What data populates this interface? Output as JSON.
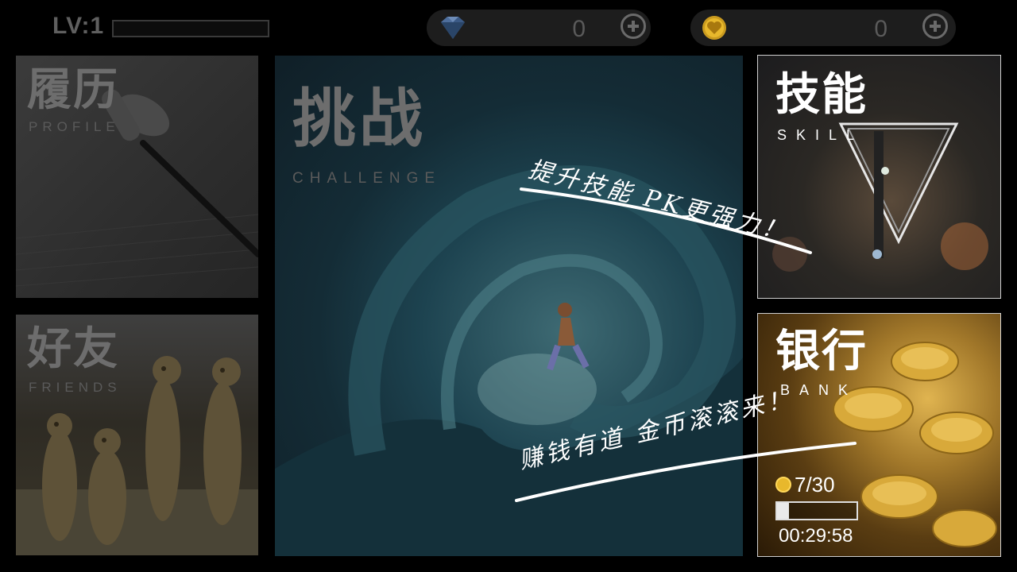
{
  "hud": {
    "level_label": "LV:1",
    "xp_progress": 0,
    "gems": {
      "icon": "diamond-icon",
      "value": "0"
    },
    "hearts": {
      "icon": "heart-coin-icon",
      "value": "0"
    }
  },
  "tiles": {
    "profile": {
      "title": "履历",
      "subtitle": "PROFILE"
    },
    "friends": {
      "title": "好友",
      "subtitle": "FRIENDS"
    },
    "challenge": {
      "title": "挑战",
      "subtitle": "CHALLENGE"
    },
    "skill": {
      "title": "技能",
      "subtitle": "SKILL"
    },
    "bank": {
      "title": "银行",
      "subtitle": "BANK",
      "coins": "7/30",
      "progress": 0.15,
      "timer": "00:29:58"
    }
  },
  "captions": {
    "skill_hint": "提升技能 PK更强力！",
    "bank_hint": "赚钱有道 金币滚滚来！"
  },
  "colors": {
    "accent_gold": "#e8b82c",
    "inactive_text": "#6d6d6d"
  }
}
